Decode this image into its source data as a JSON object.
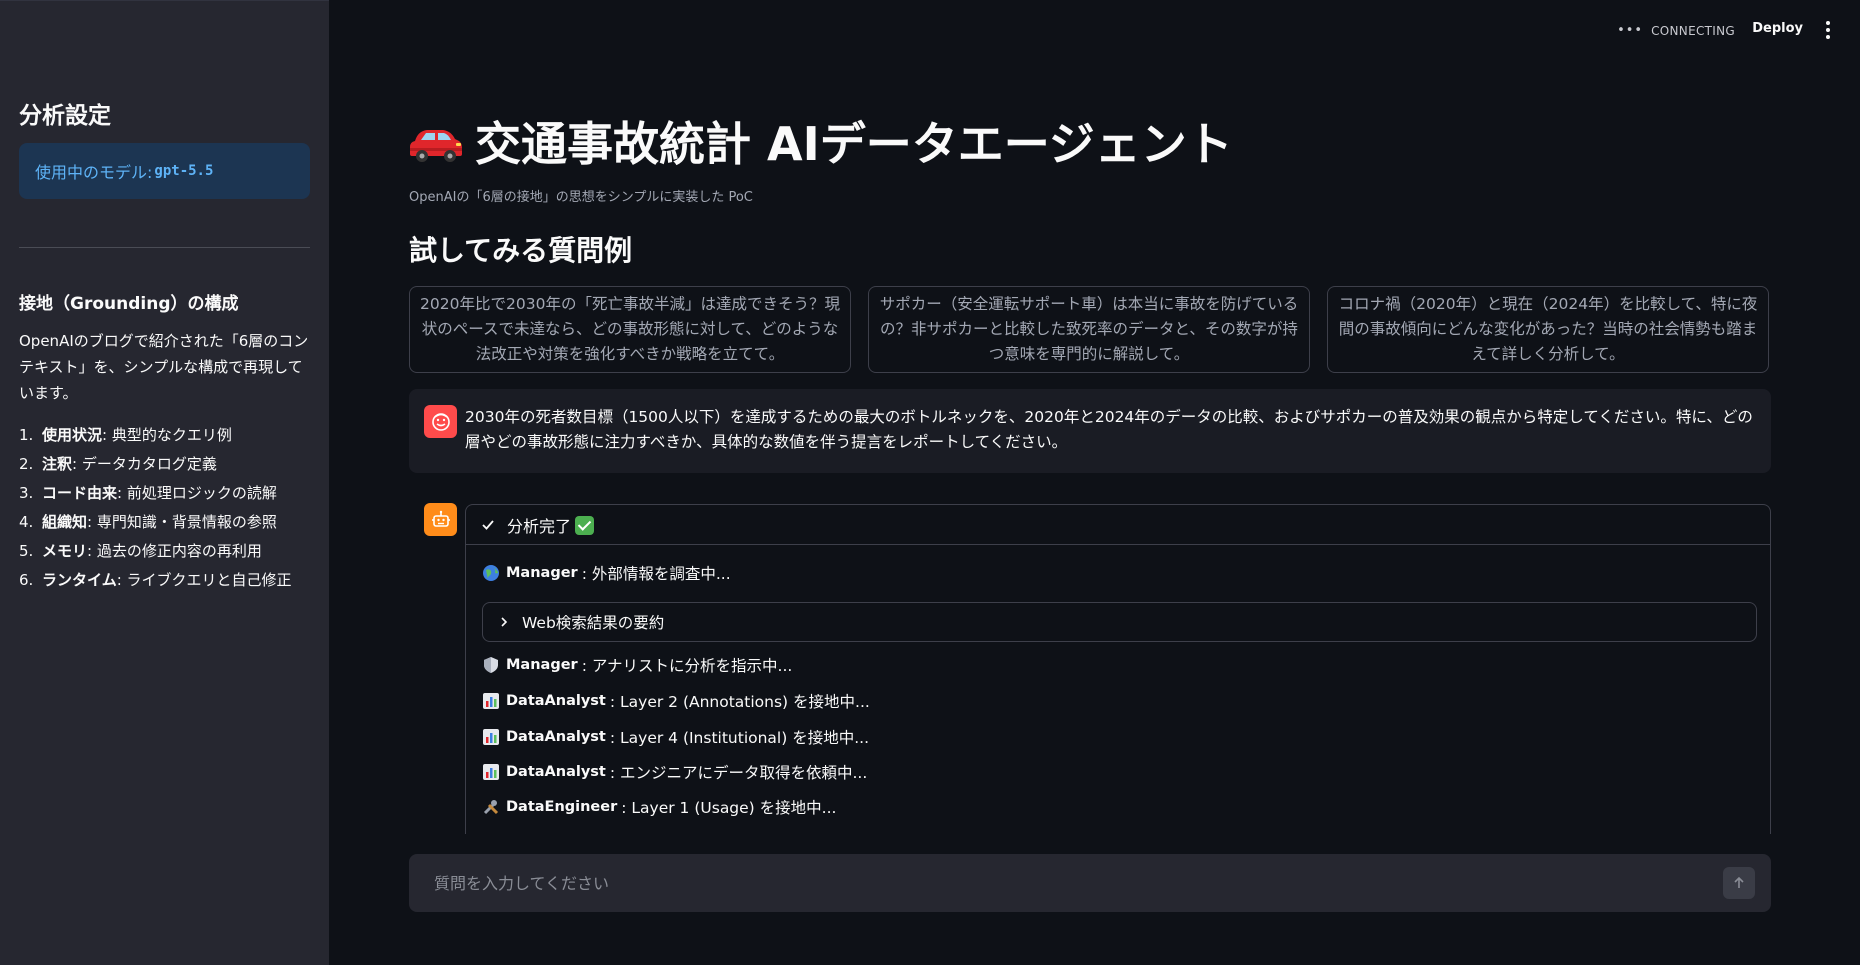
{
  "topbar": {
    "status_text": "CONNECTING",
    "deploy_label": "Deploy"
  },
  "sidebar": {
    "title": "分析設定",
    "model_prefix": "使用中のモデル: ",
    "model_name": "gpt-5.5",
    "section_title": "接地（Grounding）の構成",
    "description": "OpenAIのブログで紹介された「6層のコンテキスト」を、シンプルな構成で再現しています。",
    "layers": [
      {
        "num": "1.",
        "name": "使用状況",
        "desc": ": 典型的なクエリ例"
      },
      {
        "num": "2.",
        "name": "注釈",
        "desc": ": データカタログ定義"
      },
      {
        "num": "3.",
        "name": "コード由来",
        "desc": ": 前処理ロジックの読解"
      },
      {
        "num": "4.",
        "name": "組織知",
        "desc": ": 専門知識・背景情報の参照"
      },
      {
        "num": "5.",
        "name": "メモリ",
        "desc": ": 過去の修正内容の再利用"
      },
      {
        "num": "6.",
        "name": "ランタイム",
        "desc": ": ライブクエリと自己修正"
      }
    ]
  },
  "main": {
    "title": "交通事故統計 AIデータエージェント",
    "caption": "OpenAIの「6層の接地」の思想をシンプルに実装した PoC",
    "examples_heading": "試してみる質問例",
    "examples": [
      "2020年比で2030年の「死亡事故半減」は達成できそう？現状のペースで未達なら、どの事故形態に対して、どのような法改正や対策を強化すべきか戦略を立てて。",
      "サポカー（安全運転サポート車）は本当に事故を防げているの？非サポカーと比較した致死率のデータと、その数字が持つ意味を専門的に解説して。",
      "コロナ禍（2020年）と現在（2024年）を比較して、特に夜間の事故傾向にどんな変化があった？当時の社会情勢も踏まえて詳しく分析して。"
    ],
    "user_message": "2030年の死者数目標（1500人以下）を達成するための最大のボトルネックを、2020年と2024年のデータの比較、およびサポカーの普及効果の観点から特定してください。特に、どの層やどの事故形態に注力すべきか、具体的な数値を伴う提言をレポートしてください。",
    "status_label": "分析完了",
    "log": {
      "l1_agent": "Manager",
      "l1_text": ": 外部情報を調査中...",
      "expander_label": "Web検索結果の要約",
      "l2_agent": "Manager",
      "l2_text": ": アナリストに分析を指示中...",
      "l3_agent": "DataAnalyst",
      "l3_text": ": Layer 2 (Annotations) を接地中...",
      "l4_agent": "DataAnalyst",
      "l4_text": ": Layer 4 (Institutional) を接地中...",
      "l5_agent": "DataAnalyst",
      "l5_text": ": エンジニアにデータ取得を依頼中...",
      "l6_agent": "DataEngineer",
      "l6_text": ": Layer 1 (Usage) を接地中..."
    },
    "input_placeholder": "質問を入力してください"
  }
}
